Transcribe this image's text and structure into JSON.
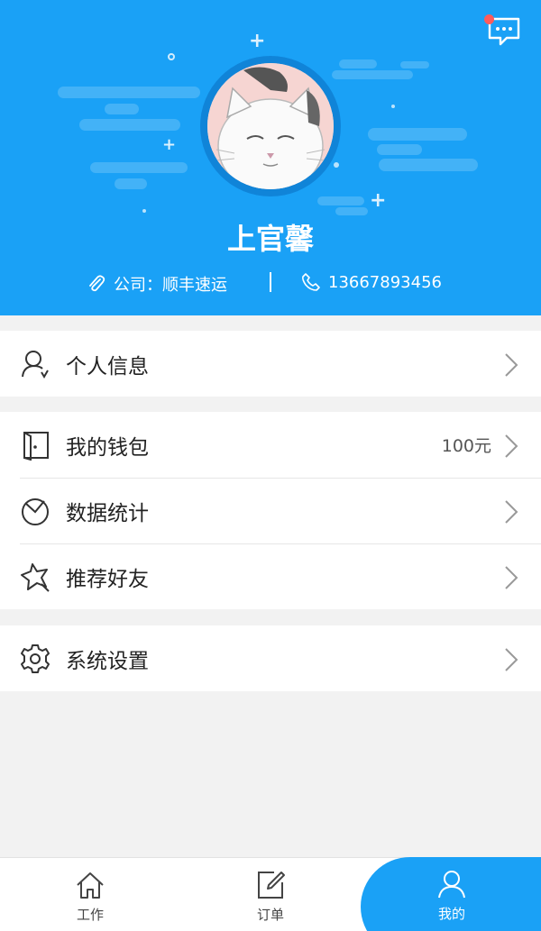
{
  "header": {
    "user_name": "上官馨",
    "company_text": "公司：顺丰速运",
    "phone_text": "13667893456",
    "background_color": "#1aa1f6",
    "message_badge_color": "#ff5b5b"
  },
  "menu": {
    "group1": [
      {
        "label": "个人信息",
        "icon": "user-icon"
      }
    ],
    "group2": [
      {
        "label": "我的钱包",
        "icon": "wallet-icon",
        "value": "100元"
      },
      {
        "label": "数据统计",
        "icon": "pie-chart-icon"
      },
      {
        "label": "推荐好友",
        "icon": "star-icon"
      }
    ],
    "group3": [
      {
        "label": "系统设置",
        "icon": "gear-icon"
      }
    ]
  },
  "bottom_nav": {
    "tabs": [
      {
        "label": "工作",
        "icon": "home-icon"
      },
      {
        "label": "订单",
        "icon": "edit-icon"
      },
      {
        "label": "我的",
        "icon": "person-icon",
        "active": true
      }
    ],
    "active_color": "#1aa1f6"
  }
}
